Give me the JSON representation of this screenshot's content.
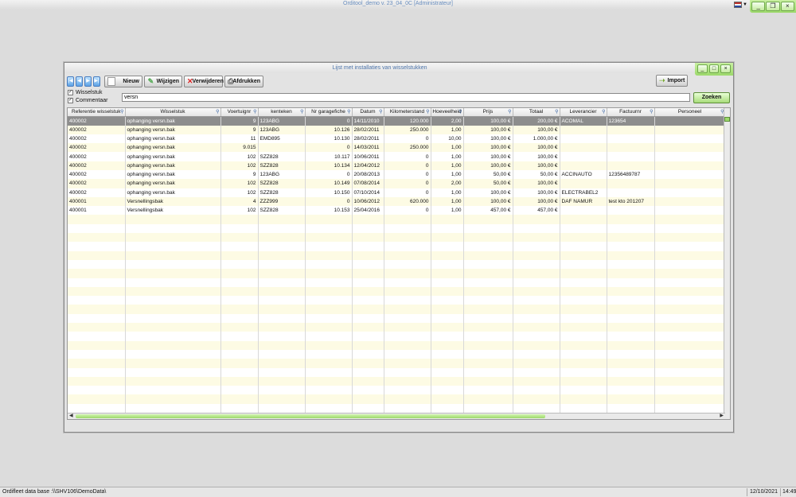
{
  "app": {
    "title": "Orditool_demo v. 23_04_0C [Administrateur]",
    "controls": [
      "_",
      "❐",
      "×"
    ]
  },
  "dialog": {
    "title": "Lijst met installaties van wisselstukken",
    "controls": [
      "_",
      "□",
      "×"
    ]
  },
  "toolbar": {
    "new_label": "Nieuw",
    "edit_label": "Wijzigen",
    "delete_label": "Verwijderen",
    "print_label": "Afdrukken",
    "import_label": "Import"
  },
  "filters": {
    "wisselstuk_label": "Wisselstuk",
    "commentaar_label": "Commentaar",
    "search_value": "versn",
    "search_button": "Zoeken"
  },
  "grid": {
    "columns": [
      "Referentie wisselstuk",
      "Wisselstuk",
      "Voertuignr",
      "kenteken",
      "Nr garagefiche",
      "Datum",
      "Kilometerstand",
      "Hoeveelheid",
      "Prijs",
      "Totaal",
      "Leverancier",
      "Factuurnr",
      "Personeel"
    ],
    "rows": [
      [
        "400002",
        "ophanging versn.bak",
        "9",
        "123ABG",
        "0",
        "14/11/2010",
        "120.000",
        "2,00",
        "100,00 €",
        "200,00 €",
        "ACOMAL",
        "123654",
        ""
      ],
      [
        "400002",
        "ophanging versn.bak",
        "9",
        "123ABG",
        "10.126",
        "28/02/2011",
        "250.000",
        "1,00",
        "100,00 €",
        "100,00 €",
        "",
        "",
        ""
      ],
      [
        "400002",
        "ophanging versn.bak",
        "11",
        "EMD895",
        "10.130",
        "28/02/2011",
        "0",
        "10,00",
        "100,00 €",
        "1.000,00 €",
        "",
        "",
        ""
      ],
      [
        "400002",
        "ophanging versn.bak",
        "9.015",
        "",
        "0",
        "14/03/2011",
        "250.000",
        "1,00",
        "100,00 €",
        "100,00 €",
        "",
        "",
        ""
      ],
      [
        "400002",
        "ophanging versn.bak",
        "102",
        "SZZ828",
        "10.117",
        "10/06/2011",
        "0",
        "1,00",
        "100,00 €",
        "100,00 €",
        "",
        "",
        ""
      ],
      [
        "400002",
        "ophanging versn.bak",
        "102",
        "SZZ828",
        "10.134",
        "12/04/2012",
        "0",
        "1,00",
        "100,00 €",
        "100,00 €",
        "",
        "",
        ""
      ],
      [
        "400002",
        "ophanging versn.bak",
        "9",
        "123ABG",
        "0",
        "20/08/2013",
        "0",
        "1,00",
        "50,00 €",
        "50,00 €",
        "ACCINAUTO",
        "12356489787",
        ""
      ],
      [
        "400002",
        "ophanging versn.bak",
        "102",
        "SZZ828",
        "10.149",
        "07/08/2014",
        "0",
        "2,00",
        "50,00 €",
        "100,00 €",
        "",
        "",
        ""
      ],
      [
        "400002",
        "ophanging versn.bak",
        "102",
        "SZZ828",
        "10.150",
        "07/10/2014",
        "0",
        "1,00",
        "100,00 €",
        "100,00 €",
        "ELECTRABEL2",
        "",
        ""
      ],
      [
        "400001",
        "Versnellingsbak",
        "4",
        "ZZZ999",
        "0",
        "10/06/2012",
        "620.000",
        "1,00",
        "100,00 €",
        "100,00 €",
        "DAF NAMUR",
        "test kto 201207",
        ""
      ],
      [
        "400001",
        "Versnellingsbak",
        "102",
        "SZZ828",
        "10.153",
        "25/04/2016",
        "0",
        "1,00",
        "457,00 €",
        "457,00 €",
        "",
        "",
        ""
      ]
    ],
    "selected_row": 0
  },
  "status": {
    "database": "Ordifleet data base :\\\\SHV106\\DemoData\\",
    "date": "12/10/2021",
    "time": "14:49:"
  }
}
